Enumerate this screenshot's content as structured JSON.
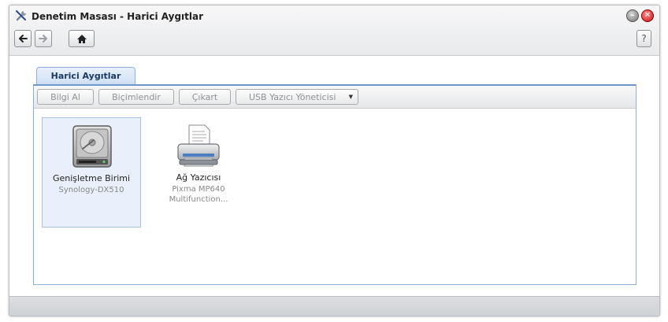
{
  "window": {
    "title": "Denetim Masası - Harici Aygıtlar",
    "app_icon": "wrench-screwdriver-icon",
    "minimize_icon": "minimize-icon",
    "close_icon": "close-icon"
  },
  "nav": {
    "back_icon": "arrow-left-icon",
    "forward_icon": "arrow-right-icon",
    "home_icon": "home-icon",
    "help_label": "?"
  },
  "tabs": [
    {
      "label": "Harici Aygıtlar",
      "active": true
    }
  ],
  "toolbar": {
    "info_label": "Bilgi Al",
    "format_label": "Biçimlendir",
    "eject_label": "Çıkart",
    "usb_manager_label": "USB Yazıcı Yöneticisi"
  },
  "devices": [
    {
      "name": "Genişletme Birimi",
      "sub": "Synology-DX510",
      "icon": "hard-drive-icon",
      "selected": true
    },
    {
      "name": "Ağ Yazıcısı",
      "sub": "Pixma MP640 Multifunction...",
      "icon": "printer-icon",
      "selected": false
    }
  ],
  "colors": {
    "accent": "#6d97cc",
    "tab_text": "#1b3a66",
    "close_button": "#c91212"
  }
}
